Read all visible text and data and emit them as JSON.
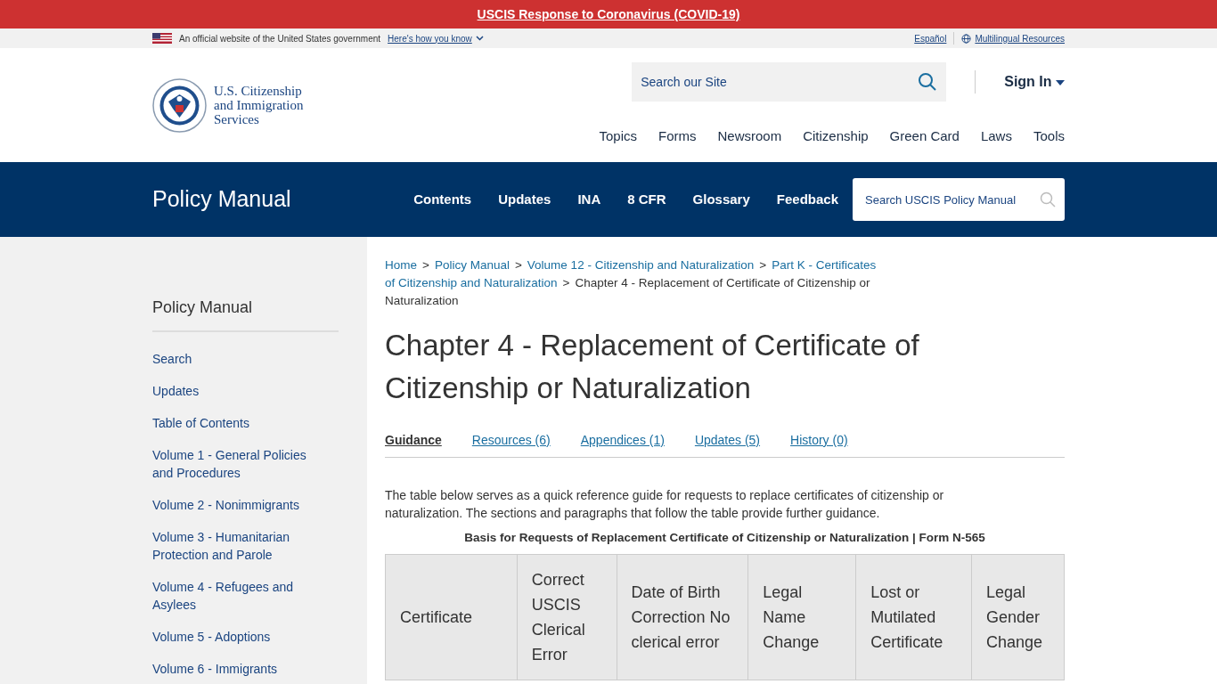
{
  "alert_bar": {
    "link": "USCIS Response to Coronavirus (COVID-19)"
  },
  "gov_banner": {
    "text": "An official website of the United States government",
    "link": "Here's how you know",
    "language_link": "Español",
    "multilingual_link": "Multilingual Resources"
  },
  "header": {
    "logo_lines": [
      "U.S. Citizenship",
      "and Immigration",
      "Services"
    ],
    "search": {
      "placeholder": "Search our Site"
    },
    "sign_in": "Sign In",
    "nav": [
      "Topics",
      "Forms",
      "Newsroom",
      "Citizenship",
      "Green Card",
      "Laws",
      "Tools"
    ]
  },
  "policy_bar": {
    "title": "Policy Manual",
    "nav": [
      "Contents",
      "Updates",
      "INA",
      "8 CFR",
      "Glossary",
      "Feedback"
    ],
    "search": {
      "placeholder": "Search USCIS Policy Manual"
    }
  },
  "sidebar": {
    "title": "Policy Manual",
    "items": [
      "Search",
      "Updates",
      "Table of Contents",
      "Volume 1 - General Policies and Procedures",
      "Volume 2 - Nonimmigrants",
      "Volume 3 - Humanitarian Protection and Parole",
      "Volume 4 - Refugees and Asylees",
      "Volume 5 - Adoptions",
      "Volume 6 - Immigrants"
    ]
  },
  "breadcrumb": [
    [
      {
        "text": "Home",
        "kind": "link"
      },
      {
        "text": ">",
        "kind": "separator"
      },
      {
        "text": "Policy Manual",
        "kind": "link"
      },
      {
        "text": ">",
        "kind": "separator"
      },
      {
        "text": "Volume 12 - Citizenship and Naturalization",
        "kind": "link"
      },
      {
        "text": ">",
        "kind": "separator"
      },
      {
        "text": "Part K - Certificates",
        "kind": "link"
      }
    ],
    [
      {
        "text": "of Citizenship and Naturalization",
        "kind": "link"
      },
      {
        "text": ">",
        "kind": "separator"
      },
      {
        "text": "Chapter 4 - Replacement of Certificate of Citizenship or",
        "kind": "current"
      }
    ],
    [
      {
        "text": "Naturalization",
        "kind": "current"
      }
    ]
  ],
  "page_title": "Chapter 4 - Replacement of Certificate of Citizenship or Naturalization",
  "tabs": [
    {
      "label": "Guidance",
      "selected": true
    },
    {
      "label": "Resources (6)",
      "selected": false
    },
    {
      "label": "Appendices (1)",
      "selected": false
    },
    {
      "label": "Updates (5)",
      "selected": false
    },
    {
      "label": "History (0)",
      "selected": false
    }
  ],
  "intro": "The table below serves as a quick reference guide for requests to replace certificates of citizenship or naturalization. The sections and paragraphs that follow the table provide further guidance.",
  "table": {
    "caption": "Basis for Requests of Replacement Certificate of Citizenship or Naturalization | Form N-565",
    "columns": [
      "Certificate",
      "Correct USCIS Clerical Error",
      "Date of Birth Correction No clerical error",
      "Legal Name Change",
      "Lost or Mutilated Certificate",
      "Legal Gender Change"
    ]
  }
}
